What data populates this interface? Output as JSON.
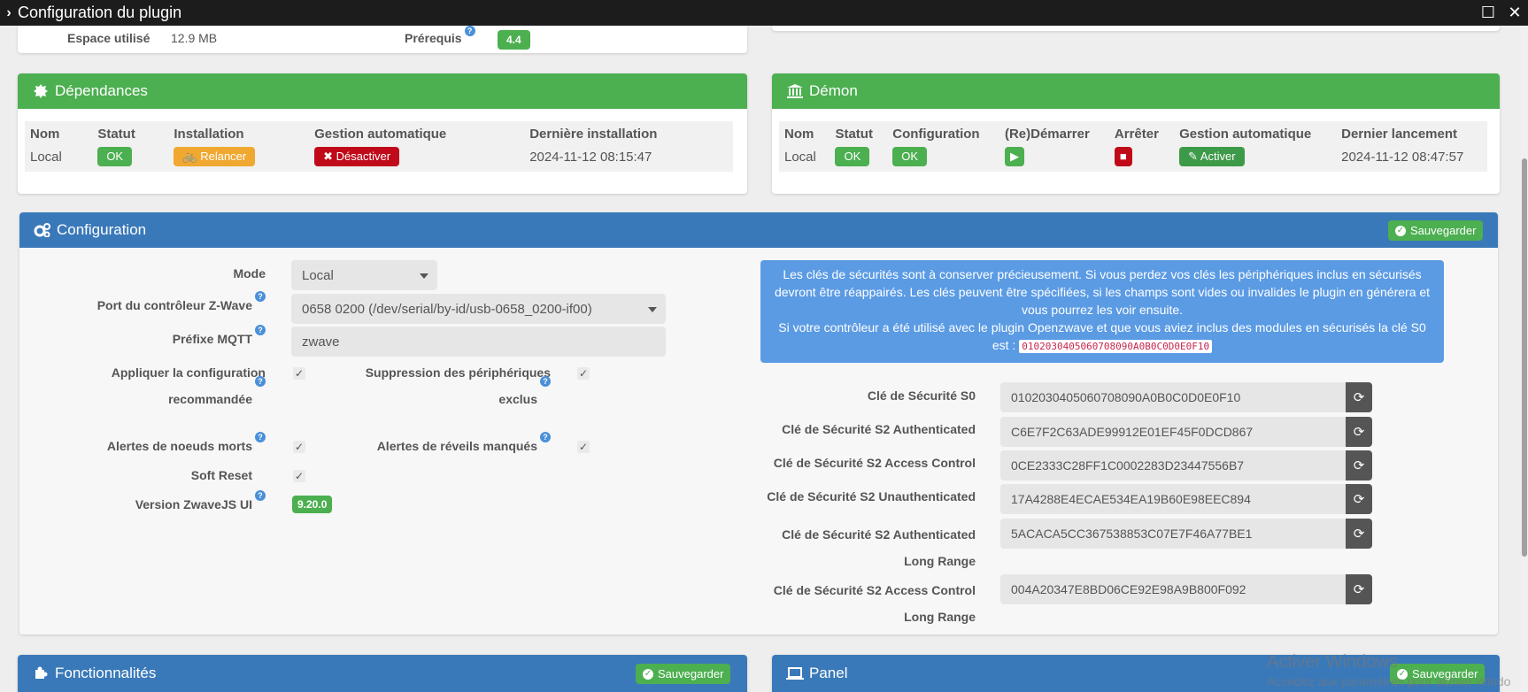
{
  "window": {
    "title": "Configuration du plugin",
    "maximize_glyph": "☐",
    "close_glyph": "✕"
  },
  "info_row": {
    "space_label": "Espace utilisé",
    "space_value": "12.9 MB",
    "prereq_label": "Prérequis",
    "prereq_value": "4.4"
  },
  "dependencies": {
    "title": "Dépendances",
    "headers": [
      "Nom",
      "Statut",
      "Installation",
      "Gestion automatique",
      "Dernière installation"
    ],
    "name": "Local",
    "status": "OK",
    "install_button": "Relancer",
    "auto_button": "Désactiver",
    "last_install": "2024-11-12 08:15:47"
  },
  "daemon": {
    "title": "Démon",
    "headers": [
      "Nom",
      "Statut",
      "Configuration",
      "(Re)Démarrer",
      "Arrêter",
      "Gestion automatique",
      "Dernier lancement"
    ],
    "name": "Local",
    "status": "OK",
    "config": "OK",
    "auto_button": "Activer",
    "last_launch": "2024-11-12 08:47:57"
  },
  "configuration": {
    "title": "Configuration",
    "save_label": "Sauvegarder",
    "mode_label": "Mode",
    "mode_value": "Local",
    "port_label": "Port du contrôleur Z-Wave",
    "port_value": "0658 0200 (/dev/serial/by-id/usb-0658_0200-if00)",
    "mqtt_label": "Préfixe MQTT",
    "mqtt_value": "zwave",
    "apply_label_1": "Appliquer la configuration",
    "apply_label_2": "recommandée",
    "suppress_label_1": "Suppression des périphériques",
    "suppress_label_2": "exclus",
    "dead_label": "Alertes de noeuds morts",
    "wake_label": "Alertes de réveils manqués",
    "soft_reset_label": "Soft Reset",
    "version_label": "Version ZwaveJS UI",
    "version_value": "9.20.0",
    "info_line1": "Les clés de sécurités sont à conserver précieusement. Si vous perdez vos clés les périphériques inclus en sécurisés devront être réappairés. Les clés peuvent être spécifiées, si les champs sont vides ou invalides le plugin en générera et vous pourrez les voir ensuite.",
    "info_line2": "Si votre contrôleur a été utilisé avec le plugin Openzwave et que vous aviez inclus des modules en sécurisés la clé S0 est :",
    "info_code": "0102030405060708090A0B0C0D0E0F10",
    "keys": [
      {
        "label": "Clé de Sécurité S0",
        "label2": "",
        "value": "0102030405060708090A0B0C0D0E0F10"
      },
      {
        "label": "Clé de Sécurité S2 Authenticated",
        "label2": "",
        "value": "C6E7F2C63ADE99912E01EF45F0DCD867"
      },
      {
        "label": "Clé de Sécurité S2 Access Control",
        "label2": "",
        "value": "0CE2333C28FF1C0002283D23447556B7"
      },
      {
        "label": "Clé de Sécurité S2 Unauthenticated",
        "label2": "",
        "value": "17A4288E4ECAE534EA19B60E98EEC894"
      },
      {
        "label": "Clé de Sécurité S2 Authenticated",
        "label2": "Long Range",
        "value": "5ACACA5CC367538853C07E7F46A77BE1"
      },
      {
        "label": "Clé de Sécurité S2 Access Control",
        "label2": "Long Range",
        "value": "004A20347E8BD06CE92E98A9B800F092"
      }
    ]
  },
  "features": {
    "title": "Fonctionnalités",
    "save_label": "Sauvegarder"
  },
  "panel": {
    "title": "Panel",
    "save_label": "Sauvegarder"
  },
  "watermark": {
    "line1": "Activer Windows",
    "line2": "Accédez aux paramètres pour activer Windo"
  },
  "colors": {
    "green": "#4caf50",
    "blue": "#3a79b9",
    "info": "#5b9be4",
    "red": "#c00a1a",
    "orange": "#f0a830"
  }
}
